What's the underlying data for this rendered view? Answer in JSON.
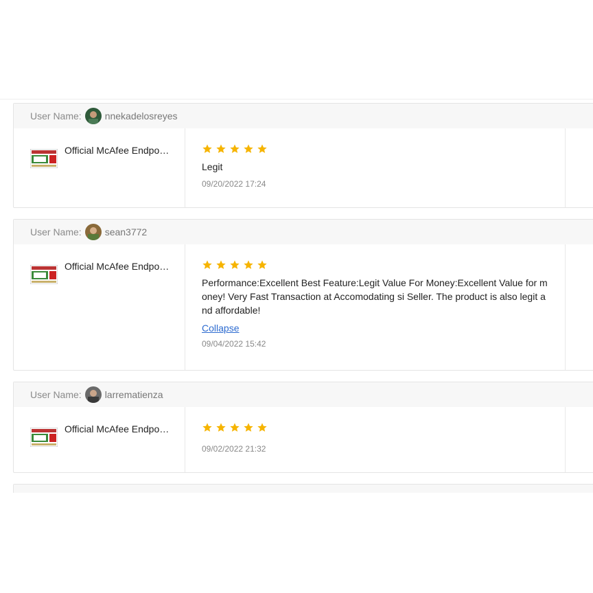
{
  "header": {
    "username_label": "User Name:"
  },
  "colors": {
    "star": "#f6b400",
    "link": "#2d6bd0",
    "header_bg": "#f7f7f7"
  },
  "reviews": [
    {
      "username": "nnekadelosreyes",
      "product_name": "Official McAfee Endpoint Security",
      "rating": 5,
      "text": "Legit",
      "collapse_label": "",
      "date": "09/20/2022 17:24"
    },
    {
      "username": "sean3772",
      "product_name": "Official McAfee Endpoint Security",
      "rating": 5,
      "text": "Performance:Excellent Best Feature:Legit Value For Money:Excellent Value for money! Very Fast Transaction at Accomodating si Seller. The product is also legit and affordable!",
      "collapse_label": "Collapse",
      "date": "09/04/2022 15:42"
    },
    {
      "username": "larrematienza",
      "product_name": "Official McAfee Endpoint Security",
      "rating": 5,
      "text": "",
      "collapse_label": "",
      "date": "09/02/2022 21:32"
    },
    {
      "username": "",
      "product_name": "",
      "rating": 0,
      "text": "",
      "collapse_label": "",
      "date": ""
    }
  ]
}
